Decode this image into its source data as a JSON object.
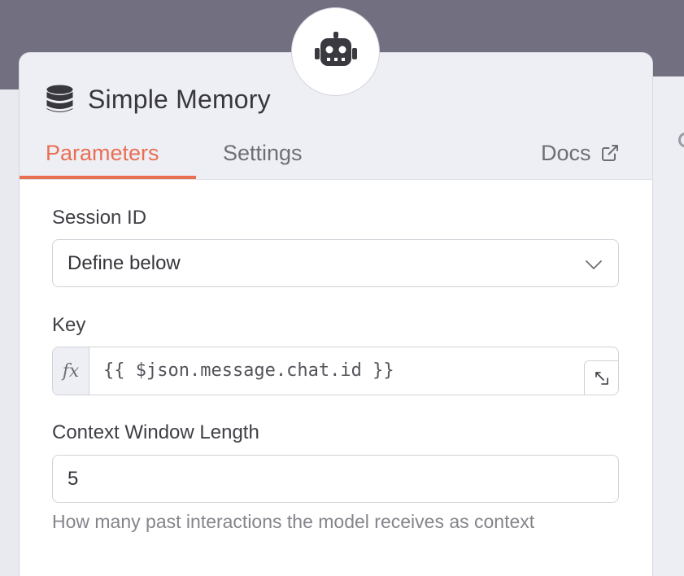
{
  "node": {
    "icon": "robot-icon",
    "title": "Simple Memory",
    "title_icon": "database-icon"
  },
  "tabs": {
    "parameters": "Parameters",
    "settings": "Settings",
    "active": "parameters"
  },
  "docs": {
    "label": "Docs",
    "icon": "external-link-icon"
  },
  "fields": {
    "session_id": {
      "label": "Session ID",
      "value": "Define below",
      "icon": "chevron-down-icon"
    },
    "key": {
      "label": "Key",
      "fx_label": "fx",
      "expression": "{{ $json.message.chat.id }}",
      "expand_icon": "expand-icon"
    },
    "context_window_length": {
      "label": "Context Window Length",
      "value": "5",
      "hint": "How many past interactions the model receives as context"
    }
  },
  "colors": {
    "accent": "#e96f53",
    "backdrop": "#726f80",
    "header_bg": "#eeeff5"
  }
}
